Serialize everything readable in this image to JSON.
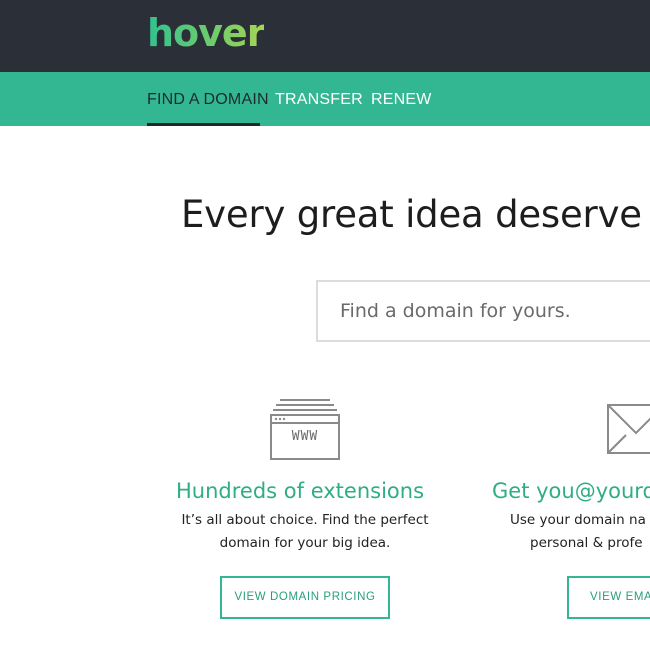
{
  "header": {
    "logo_text": "hover"
  },
  "nav": {
    "items": [
      {
        "label": "FIND A DOMAIN",
        "active": true
      },
      {
        "label": "TRANSFER",
        "active": false
      },
      {
        "label": "RENEW",
        "active": false
      }
    ]
  },
  "hero": {
    "headline": "Every great idea deserve"
  },
  "search": {
    "placeholder": "Find a domain for yours."
  },
  "features": [
    {
      "icon": "www-browser-icon",
      "icon_text": "WWW",
      "title": "Hundreds of extensions",
      "desc_line1": "It’s all about choice. Find the perfect",
      "desc_line2": "domain for your big idea.",
      "button_label": "VIEW DOMAIN PRICING"
    },
    {
      "icon": "envelope-icon",
      "title": "Get you@yourd",
      "desc_line1": "Use your domain na",
      "desc_line2": "personal & profe",
      "button_label": "VIEW EMAIL"
    }
  ],
  "colors": {
    "topbar": "#2b2f38",
    "nav_green": "#33b793",
    "accent_text": "#2fae86"
  }
}
